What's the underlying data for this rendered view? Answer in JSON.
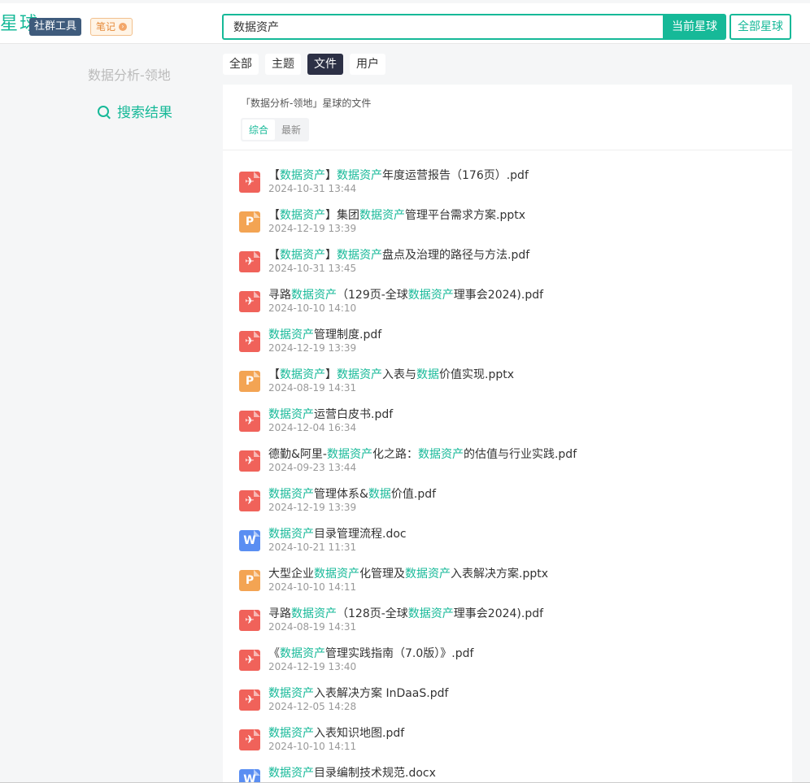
{
  "header": {
    "logo": "星球",
    "badge_tool": "社群工具",
    "badge_note": "笔记",
    "search_value": "数据资产",
    "btn_current": "当前星球",
    "btn_all": "全部星球"
  },
  "sidebar": {
    "title": "数据分析-领地",
    "result_label": "搜索结果"
  },
  "tabs": [
    "全部",
    "主题",
    "文件",
    "用户"
  ],
  "active_tab": "文件",
  "panel": {
    "caption": "「数据分析-领地」星球的文件",
    "sort": [
      "综合",
      "最新"
    ],
    "active_sort": "综合"
  },
  "files": [
    {
      "type": "pdf",
      "name": [
        [
          "【",
          0
        ],
        [
          "数据资产",
          1
        ],
        [
          "】",
          0
        ],
        [
          "数据资产",
          1
        ],
        [
          "年度运营报告（176页）.pdf",
          0
        ]
      ],
      "time": "2024-10-31 13:44"
    },
    {
      "type": "ppt",
      "name": [
        [
          "【",
          0
        ],
        [
          "数据资产",
          1
        ],
        [
          "】集团",
          0
        ],
        [
          "数据资产",
          1
        ],
        [
          "管理平台需求方案.pptx",
          0
        ]
      ],
      "time": "2024-12-19 13:39"
    },
    {
      "type": "pdf",
      "name": [
        [
          "【",
          0
        ],
        [
          "数据资产",
          1
        ],
        [
          "】",
          0
        ],
        [
          "数据资产",
          1
        ],
        [
          "盘点及治理的路径与方法.pdf",
          0
        ]
      ],
      "time": "2024-10-31 13:45"
    },
    {
      "type": "pdf",
      "name": [
        [
          "寻路",
          0
        ],
        [
          "数据资产",
          1
        ],
        [
          "（129页-全球",
          0
        ],
        [
          "数据资产",
          1
        ],
        [
          "理事会2024).pdf",
          0
        ]
      ],
      "time": "2024-10-10 14:10"
    },
    {
      "type": "pdf",
      "name": [
        [
          "数据资产",
          1
        ],
        [
          "管理制度.pdf",
          0
        ]
      ],
      "time": "2024-12-19 13:39"
    },
    {
      "type": "ppt",
      "name": [
        [
          "【",
          0
        ],
        [
          "数据资产",
          1
        ],
        [
          "】",
          0
        ],
        [
          "数据资产",
          1
        ],
        [
          "入表与",
          0
        ],
        [
          "数据",
          1
        ],
        [
          "价值实现.pptx",
          0
        ]
      ],
      "time": "2024-08-19 14:31"
    },
    {
      "type": "pdf",
      "name": [
        [
          "数据资产",
          1
        ],
        [
          "运营白皮书.pdf",
          0
        ]
      ],
      "time": "2024-12-04 16:34"
    },
    {
      "type": "pdf",
      "name": [
        [
          "德勤&阿里-",
          0
        ],
        [
          "数据资产",
          1
        ],
        [
          "化之路：",
          0
        ],
        [
          "数据资产",
          1
        ],
        [
          "的估值与行业实践.pdf",
          0
        ]
      ],
      "time": "2024-09-23 13:44"
    },
    {
      "type": "pdf",
      "name": [
        [
          "数据资产",
          1
        ],
        [
          "管理体系&",
          0
        ],
        [
          "数据",
          1
        ],
        [
          "价值.pdf",
          0
        ]
      ],
      "time": "2024-12-19 13:39"
    },
    {
      "type": "doc",
      "name": [
        [
          "数据资产",
          1
        ],
        [
          "目录管理流程.doc",
          0
        ]
      ],
      "time": "2024-10-21 11:31"
    },
    {
      "type": "ppt",
      "name": [
        [
          "大型企业",
          0
        ],
        [
          "数据资产",
          1
        ],
        [
          "化管理及",
          0
        ],
        [
          "数据资产",
          1
        ],
        [
          "入表解决方案.pptx",
          0
        ]
      ],
      "time": "2024-10-10 14:11"
    },
    {
      "type": "pdf",
      "name": [
        [
          "寻路",
          0
        ],
        [
          "数据资产",
          1
        ],
        [
          "（128页-全球",
          0
        ],
        [
          "数据资产",
          1
        ],
        [
          "理事会2024).pdf",
          0
        ]
      ],
      "time": "2024-08-19 14:31"
    },
    {
      "type": "pdf",
      "name": [
        [
          "《",
          0
        ],
        [
          "数据资产",
          1
        ],
        [
          "管理实践指南（7.0版）》.pdf",
          0
        ]
      ],
      "time": "2024-12-19 13:40"
    },
    {
      "type": "pdf",
      "name": [
        [
          "数据资产",
          1
        ],
        [
          "入表解决方案 InDaaS.pdf",
          0
        ]
      ],
      "time": "2024-12-05 14:28"
    },
    {
      "type": "pdf",
      "name": [
        [
          "数据资产",
          1
        ],
        [
          "入表知识地图.pdf",
          0
        ]
      ],
      "time": "2024-10-10 14:11"
    },
    {
      "type": "doc",
      "name": [
        [
          "数据资产",
          1
        ],
        [
          "目录编制技术规范.docx",
          0
        ]
      ],
      "time": ""
    }
  ]
}
